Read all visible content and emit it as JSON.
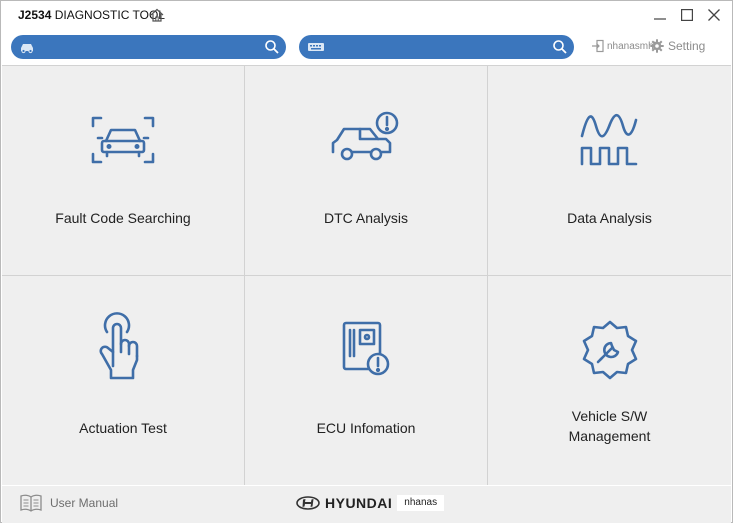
{
  "window": {
    "title_bold": "J2534",
    "title_rest": " DIAGNOSTIC TOOL"
  },
  "search": {
    "vehicle_placeholder": "",
    "code_placeholder": ""
  },
  "header": {
    "username": "nhanasmhh",
    "setting_label": "Setting"
  },
  "tiles": [
    {
      "label": "Fault Code Searching",
      "icon": "car-scan-icon"
    },
    {
      "label": "DTC Analysis",
      "icon": "car-alert-icon"
    },
    {
      "label": "Data Analysis",
      "icon": "waveform-icon"
    },
    {
      "label": "Actuation Test",
      "icon": "hand-touch-icon"
    },
    {
      "label": "ECU Infomation",
      "icon": "ecu-alert-icon"
    },
    {
      "label": "Vehicle S/W\nManagement",
      "icon": "gear-wrench-icon"
    }
  ],
  "footer": {
    "manual_label": "User Manual",
    "brand_name": "HYUNDAI",
    "brand_user": "nhanas"
  },
  "colors": {
    "accent": "#3b76bd",
    "icon": "#3f6ea8",
    "tile_bg": "#efefef"
  }
}
